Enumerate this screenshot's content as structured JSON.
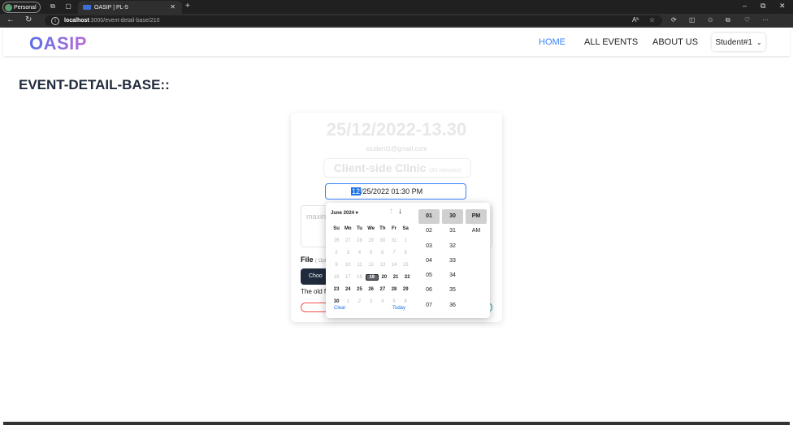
{
  "browser": {
    "profile": "Personal",
    "tab_title": "OASIP | PL-5",
    "url_host": "localhost",
    "url_path": ":3000/event-detail-base/210",
    "reader_label": "Aʰ"
  },
  "nav": {
    "logo": "OASIP",
    "links": [
      "HOME",
      "ALL EVENTS",
      "ABOUT US"
    ],
    "user": "Student#1"
  },
  "page": {
    "heading": "EVENT-DETAIL-BASE::"
  },
  "event": {
    "start": "25/12/2022-13.30",
    "email": "student1@gmail.com",
    "category": "Client-side Clinic",
    "duration": "(30 minutes)",
    "dt_month": "12",
    "dt_rest": "/25/2022 01:30 PM",
    "notes_placeholder": "maxin",
    "file_label": "File",
    "file_optional": "( Opt",
    "choose_label": "Choo",
    "old_file_text": "The old f",
    "old_file_end": "d."
  },
  "picker": {
    "month_label": "June 2024 ▾",
    "weekdays": [
      "Su",
      "Mo",
      "Tu",
      "We",
      "Th",
      "Fr",
      "Sa"
    ],
    "weeks": [
      [
        "26",
        "27",
        "28",
        "29",
        "30",
        "31",
        "1"
      ],
      [
        "2",
        "3",
        "4",
        "5",
        "6",
        "7",
        "8"
      ],
      [
        "9",
        "10",
        "11",
        "12",
        "13",
        "14",
        "15"
      ],
      [
        "16",
        "17",
        "18",
        "19",
        "20",
        "21",
        "22"
      ],
      [
        "23",
        "24",
        "25",
        "26",
        "27",
        "28",
        "29"
      ],
      [
        "30",
        "1",
        "2",
        "3",
        "4",
        "5",
        "6"
      ]
    ],
    "today_day": "19",
    "clear": "Clear",
    "today": "Today",
    "hours": [
      "01",
      "02",
      "03",
      "04",
      "05",
      "06",
      "07"
    ],
    "minutes": [
      "30",
      "31",
      "32",
      "33",
      "34",
      "35",
      "36"
    ],
    "ampm": [
      "PM",
      "AM"
    ]
  }
}
